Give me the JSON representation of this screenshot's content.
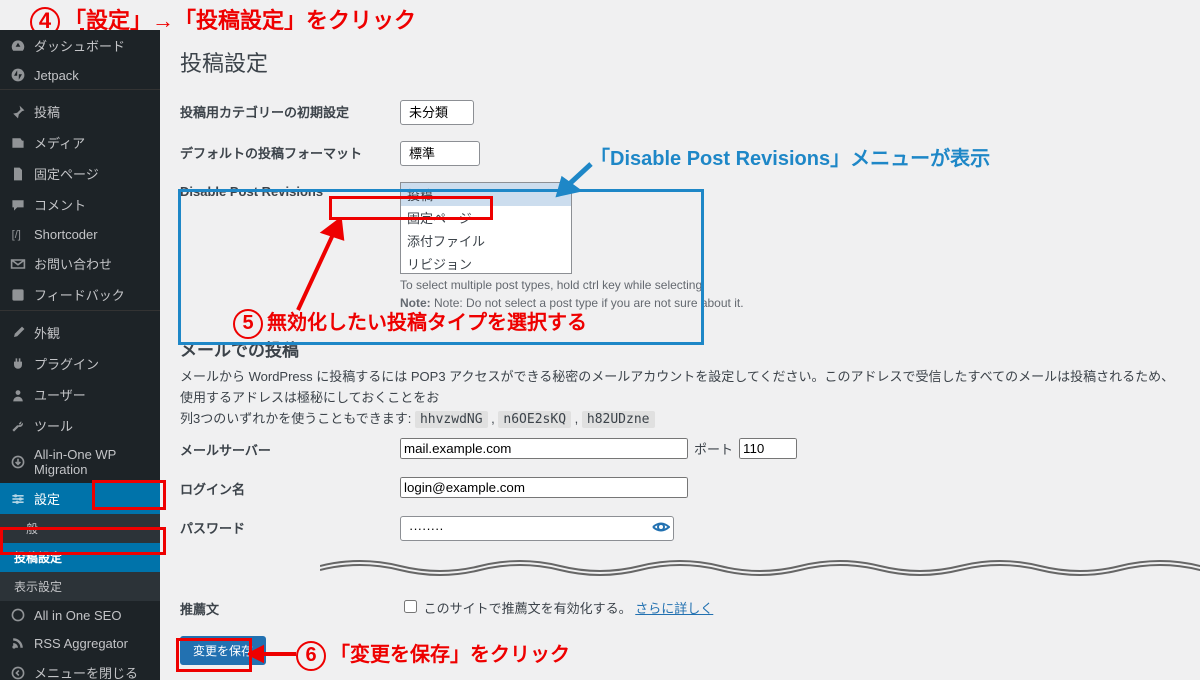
{
  "annotations": {
    "step4": "「設定」→「投稿設定」をクリック",
    "step5": "無効化したい投稿タイプを選択する",
    "step6": "「変更を保存」をクリック",
    "blueCallout": "「Disable Post Revisions」メニューが表示"
  },
  "sidebar": [
    {
      "icon": "tach",
      "label": "ダッシュボード"
    },
    {
      "icon": "jet",
      "label": "Jetpack"
    },
    {
      "sep": true
    },
    {
      "icon": "pin",
      "label": "投稿"
    },
    {
      "icon": "media",
      "label": "メディア"
    },
    {
      "icon": "page",
      "label": "固定ページ"
    },
    {
      "icon": "comment",
      "label": "コメント"
    },
    {
      "icon": "code",
      "label": "Shortcoder"
    },
    {
      "icon": "mail",
      "label": "お問い合わせ"
    },
    {
      "icon": "feed",
      "label": "フィードバック"
    },
    {
      "sep": true
    },
    {
      "icon": "brush",
      "label": "外観"
    },
    {
      "icon": "plug",
      "label": "プラグイン"
    },
    {
      "icon": "user",
      "label": "ユーザー"
    },
    {
      "icon": "tool",
      "label": "ツール"
    },
    {
      "icon": "migrate",
      "label": "All-in-One WP Migration"
    },
    {
      "icon": "settings",
      "label": "設定",
      "active": true
    },
    {
      "sub": true,
      "label": "一般"
    },
    {
      "sub": true,
      "label": "投稿設定",
      "active": true
    },
    {
      "sub": true,
      "label": "表示設定"
    },
    {
      "icon": "seo",
      "label": "All in One SEO"
    },
    {
      "icon": "rss",
      "label": "RSS Aggregator"
    },
    {
      "icon": "collapse",
      "label": "メニューを閉じる"
    }
  ],
  "page": {
    "title": "投稿設定",
    "defaultCategory": {
      "label": "投稿用カテゴリーの初期設定",
      "value": "未分類"
    },
    "defaultFormat": {
      "label": "デフォルトの投稿フォーマット",
      "value": "標準"
    },
    "disableRevisions": {
      "label": "Disable Post Revisions",
      "options": [
        "投稿",
        "固定ページ",
        "添付ファイル",
        "リビジョン"
      ],
      "help1": "To select multiple post types, hold ctrl key while selecting",
      "help2": "Note: Do not select a post type if you are not sure about it."
    },
    "mailSection": {
      "title": "メールでの投稿",
      "desc1": "メールから WordPress に投稿するには POP3 アクセスができる秘密のメールアカウントを設定してください。このアドレスで受信したすべてのメールは投稿されるため、使用するアドレスは極秘にしておくことをお",
      "desc2": "列3つのいずれかを使うこともできます: ",
      "codes": [
        "hhvzwdNG",
        "n6OE2sKQ",
        "h82UDzne"
      ]
    },
    "mailServer": {
      "label": "メールサーバー",
      "value": "mail.example.com",
      "portLabel": "ポート",
      "port": "110"
    },
    "loginName": {
      "label": "ログイン名",
      "value": "login@example.com"
    },
    "password": {
      "label": "パスワード",
      "value": "········"
    },
    "recommend": {
      "label": "推薦文",
      "checkbox": "このサイトで推薦文を有効化する。",
      "link": "さらに詳しく"
    },
    "save": "変更を保存"
  }
}
